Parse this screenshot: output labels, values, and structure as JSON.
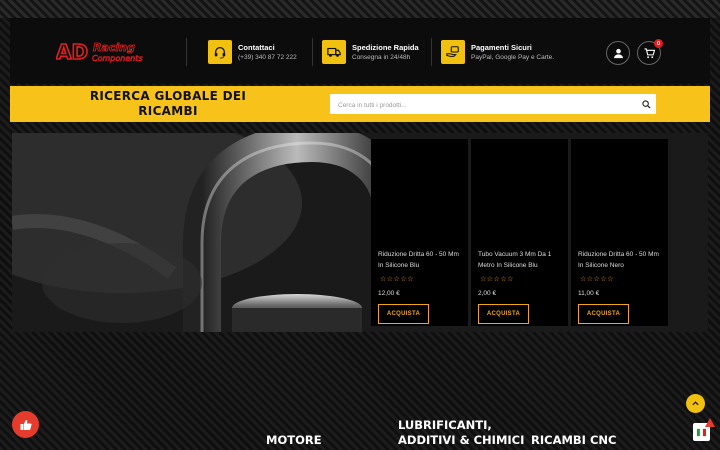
{
  "brand": {
    "logo_line1": "Racing",
    "logo_line2": "Components",
    "logo_mark": "AD",
    "accent": "#f2c10f",
    "logo_red": "#e02020"
  },
  "header": {
    "contact": {
      "title": "Contattaci",
      "subtitle": "(+39) 340 87 72 222",
      "icon": "headset-icon"
    },
    "shipping": {
      "title": "Spedizione Rapida",
      "subtitle": "Consegna in 24/48h",
      "icon": "truck-icon"
    },
    "payment": {
      "title": "Pagamenti Sicuri",
      "subtitle": "PayPal, Google Pay e Carte.",
      "icon": "hand-card-icon"
    },
    "account_icon": "user-icon",
    "cart_icon": "cart-icon",
    "cart_count": "0"
  },
  "search": {
    "title": "RICERCA GLOBALE DEI RICAMBI",
    "placeholder": "Cerca in tutti i prodotti...",
    "icon": "search-icon"
  },
  "products": [
    {
      "name": "Riduzione Dritta 60 - 50 Mm In Silicone Blu",
      "stars": "☆☆☆☆☆",
      "price": "12,00 €",
      "button": "ACQUISTA"
    },
    {
      "name": "Tubo Vacuum 3 Mm Da 1 Metro In Silicone Blu",
      "stars": "☆☆☆☆☆",
      "price": "2,00 €",
      "button": "ACQUISTA"
    },
    {
      "name": "Riduzione Dritta 60 - 50 Mm In Silicone Nero",
      "stars": "☆☆☆☆☆",
      "price": "11,00 €",
      "button": "ACQUISTA"
    }
  ],
  "footer": {
    "categories": [
      "MOTORE",
      "LUBRIFICANTI, ADDITIVI & CHIMICI",
      "RICAMBI CNC"
    ]
  }
}
